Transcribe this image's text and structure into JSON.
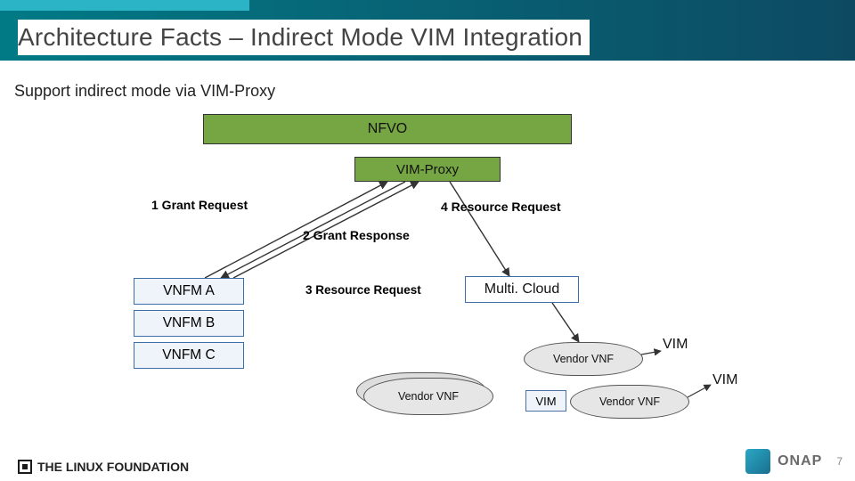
{
  "title": "Architecture Facts – Indirect Mode VIM Integration",
  "subtitle": "Support indirect mode via VIM-Proxy",
  "blocks": {
    "nfvo": "NFVO",
    "proxy": "VIM-Proxy",
    "multicloud": "Multi. Cloud"
  },
  "vnfm": [
    "VNFM A",
    "VNFM B",
    "VNFM C"
  ],
  "labels": {
    "l1": "1 Grant Request",
    "l2": "2 Grant Response",
    "l3": "3 Resource Request",
    "l4": "4 Resource Request"
  },
  "clouds": {
    "vendor_vnf": "Vendor VNF"
  },
  "vim": "VIM",
  "footer": {
    "left": "THE LINUX FOUNDATION",
    "right_brand": "ONAP",
    "right_tagline": "",
    "page": "7"
  }
}
